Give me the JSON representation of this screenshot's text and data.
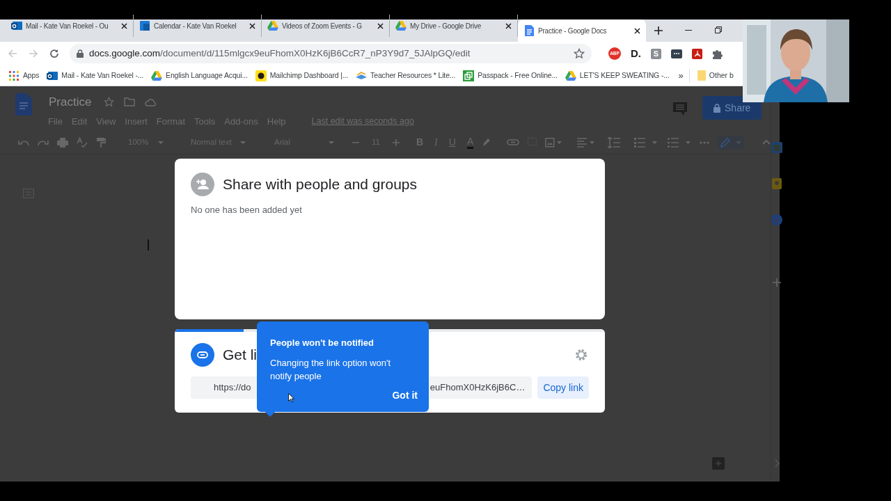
{
  "tabs": [
    {
      "kind": "mail",
      "title": "Mail - Kate Van Roekel - Ou",
      "selected": false
    },
    {
      "kind": "calendar",
      "title": "Calendar - Kate Van Roekel",
      "selected": false
    },
    {
      "kind": "drive",
      "title": "Videos of Zoom Events - G",
      "selected": false
    },
    {
      "kind": "drive",
      "title": "My Drive - Google Drive",
      "selected": false
    },
    {
      "kind": "docs",
      "title": "Practice - Google Docs",
      "selected": true
    }
  ],
  "address_bar": {
    "domain": "docs.google.com",
    "path": "/document/d/115mlgcx9euFhomX0HzK6jB6CcR7_nP3Y9d7_5JAlpGQ/edit"
  },
  "extensions": [
    {
      "kind": "abp",
      "label": "ABP"
    },
    {
      "kind": "letter",
      "label": "D."
    },
    {
      "kind": "tile",
      "label": "S"
    },
    {
      "kind": "dots"
    },
    {
      "kind": "pdf"
    },
    {
      "kind": "puzzle"
    }
  ],
  "bookmarks": [
    {
      "kind": "apps",
      "label": "Apps"
    },
    {
      "kind": "mail",
      "label": "Mail - Kate Van Roekel -..."
    },
    {
      "kind": "drive",
      "label": "English Language Acqui..."
    },
    {
      "kind": "chimp",
      "label": "Mailchimp Dashboard |..."
    },
    {
      "kind": "teacher",
      "label": "Teacher Resources * Lite..."
    },
    {
      "kind": "passpack",
      "label": "Passpack - Free Online..."
    },
    {
      "kind": "drive",
      "label": "LET'S KEEP SWEATING -..."
    }
  ],
  "bookmarks_overflow": "»",
  "other_bookmarks": "Other b",
  "document": {
    "title": "Practice",
    "menu": [
      "File",
      "Edit",
      "View",
      "Insert",
      "Format",
      "Tools",
      "Add-ons",
      "Help"
    ],
    "last_edit": "Last edit was seconds ago",
    "share_button": "Share"
  },
  "toolbar": {
    "zoom": "100%",
    "style": "Normal text",
    "font": "Arial",
    "font_size": "11",
    "bold": "B",
    "italic": "I",
    "underline": "U",
    "text_color": "A"
  },
  "share_dialog": {
    "title": "Share with people and groups",
    "empty_note": "No one has been added yet"
  },
  "link_card": {
    "title": "Get li",
    "link_start": "https://do",
    "link_end": "euFhomX0HzK6jB6C…",
    "copy_button": "Copy link",
    "progress": {
      "level": 0.16
    }
  },
  "tooltip": {
    "title": "People won't be notified",
    "body": "Changing the link option won't notify people",
    "button": "Got it"
  }
}
